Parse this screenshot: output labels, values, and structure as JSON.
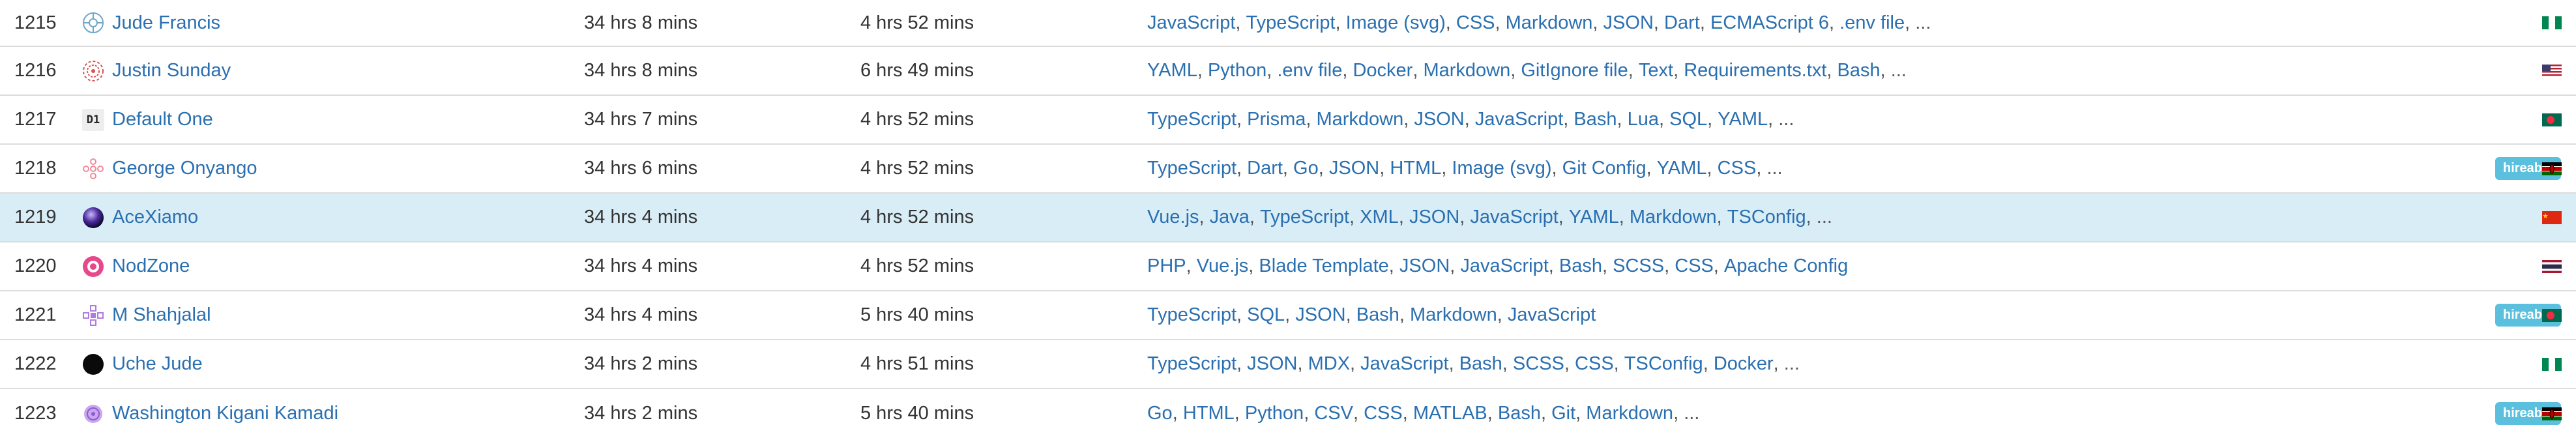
{
  "rows": [
    {
      "rank": "1215",
      "name": "Jude Francis",
      "avatar": "gear-flower-icon",
      "total": "34 hrs 8 mins",
      "daily_avg": "4 hrs 52 mins",
      "languages": [
        "JavaScript",
        "TypeScript",
        "Image (svg)",
        "CSS",
        "Markdown",
        "JSON",
        "Dart",
        "ECMAScript 6",
        ".env file"
      ],
      "more": "...",
      "hireable": "",
      "flag": "nigeria-flag"
    },
    {
      "rank": "1216",
      "name": "Justin Sunday",
      "avatar": "red-spiral-icon",
      "total": "34 hrs 8 mins",
      "daily_avg": "6 hrs 49 mins",
      "languages": [
        "YAML",
        "Python",
        ".env file",
        "Docker",
        "Markdown",
        "GitIgnore file",
        "Text",
        "Requirements.txt",
        "Bash"
      ],
      "more": "...",
      "hireable": "",
      "flag": "usa-flag"
    },
    {
      "rank": "1217",
      "name": "Default One",
      "avatar_text": "D1",
      "avatar": "d1-avatar",
      "total": "34 hrs 7 mins",
      "daily_avg": "4 hrs 52 mins",
      "languages": [
        "TypeScript",
        "Prisma",
        "Markdown",
        "JSON",
        "JavaScript",
        "Bash",
        "Lua",
        "SQL",
        "YAML"
      ],
      "more": "...",
      "hireable": "",
      "flag": "bangladesh-flag"
    },
    {
      "rank": "1218",
      "name": "George Onyango",
      "avatar": "pink-flower-icon",
      "total": "34 hrs 6 mins",
      "daily_avg": "4 hrs 52 mins",
      "languages": [
        "TypeScript",
        "Dart",
        "Go",
        "JSON",
        "HTML",
        "Image (svg)",
        "Git Config",
        "YAML",
        "CSS"
      ],
      "more": "...",
      "hireable": "hireable",
      "flag": "kenya-flag"
    },
    {
      "rank": "1219",
      "name": "AceXiamo",
      "avatar": "planet-photo-icon",
      "total": "34 hrs 4 mins",
      "daily_avg": "4 hrs 52 mins",
      "languages": [
        "Vue.js",
        "Java",
        "TypeScript",
        "XML",
        "JSON",
        "JavaScript",
        "YAML",
        "Markdown",
        "TSConfig"
      ],
      "more": "...",
      "hireable": "",
      "flag": "china-flag"
    },
    {
      "rank": "1220",
      "name": "NodZone",
      "avatar": "pink-circle-icon",
      "total": "34 hrs 4 mins",
      "daily_avg": "4 hrs 52 mins",
      "languages": [
        "PHP",
        "Vue.js",
        "Blade Template",
        "JSON",
        "JavaScript",
        "Bash",
        "SCSS",
        "CSS",
        "Apache Config"
      ],
      "more": "",
      "hireable": "",
      "flag": "thailand-flag"
    },
    {
      "rank": "1221",
      "name": "M Shahjalal",
      "avatar": "purple-flower-icon",
      "total": "34 hrs 4 mins",
      "daily_avg": "5 hrs 40 mins",
      "languages": [
        "TypeScript",
        "SQL",
        "JSON",
        "Bash",
        "Markdown",
        "JavaScript"
      ],
      "more": "",
      "hireable": "hireable",
      "flag": "bangladesh-flag"
    },
    {
      "rank": "1222",
      "name": "Uche Jude",
      "avatar": "black-circle-icon",
      "total": "34 hrs 2 mins",
      "daily_avg": "4 hrs 51 mins",
      "languages": [
        "TypeScript",
        "JSON",
        "MDX",
        "JavaScript",
        "Bash",
        "SCSS",
        "CSS",
        "TSConfig",
        "Docker"
      ],
      "more": "...",
      "hireable": "",
      "flag": "nigeria-flag"
    },
    {
      "rank": "1223",
      "name": "Washington Kigani Kamadi",
      "avatar": "violet-flower-icon",
      "total": "34 hrs 2 mins",
      "daily_avg": "5 hrs 40 mins",
      "languages": [
        "Go",
        "HTML",
        "Python",
        "CSV",
        "CSS",
        "MATLAB",
        "Bash",
        "Git",
        "Markdown"
      ],
      "more": "...",
      "hireable": "hireable",
      "flag": "kenya-flag"
    }
  ],
  "colors": {
    "link": "#2a6fb0",
    "highlight_row": "#d9edf7",
    "hireable_badge": "#5bc0de"
  }
}
